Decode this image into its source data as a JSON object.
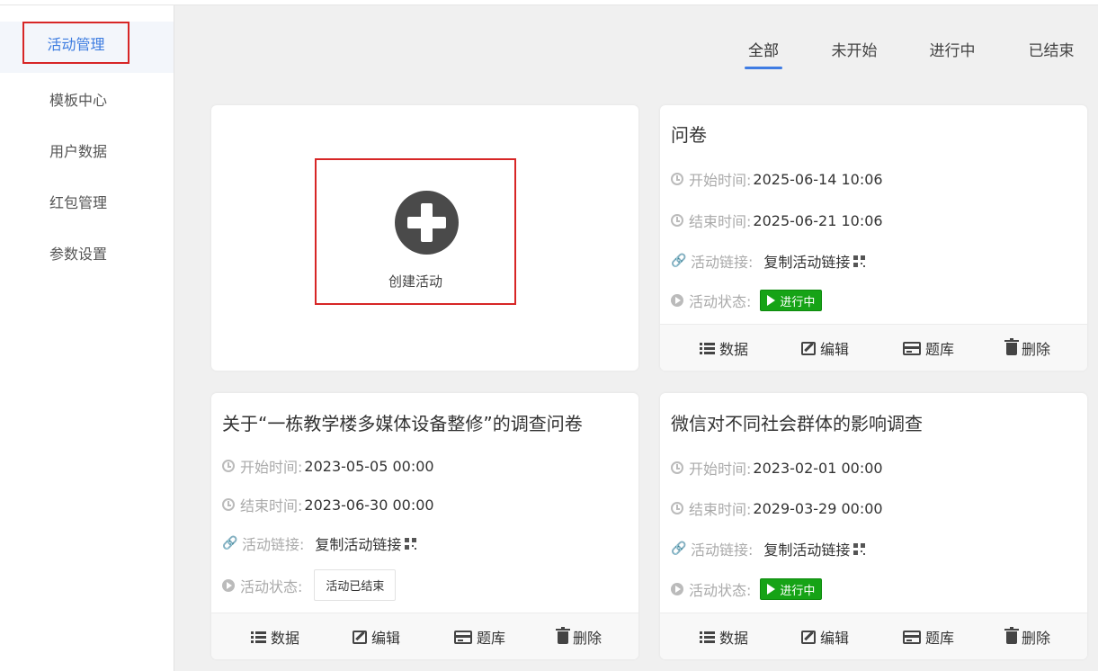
{
  "sidebar": {
    "items": [
      {
        "label": "活动管理"
      },
      {
        "label": "模板中心"
      },
      {
        "label": "用户数据"
      },
      {
        "label": "红包管理"
      },
      {
        "label": "参数设置"
      }
    ]
  },
  "tabs": [
    {
      "label": "全部"
    },
    {
      "label": "未开始"
    },
    {
      "label": "进行中"
    },
    {
      "label": "已结束"
    }
  ],
  "create": {
    "label": "创建活动"
  },
  "labels": {
    "start": "开始时间:",
    "end": "结束时间:",
    "link": "活动链接:",
    "status": "活动状态:",
    "copy_link": "复制活动链接"
  },
  "actions": {
    "data": "数据",
    "edit": "编辑",
    "bank": "题库",
    "delete": "删除"
  },
  "cards": [
    {
      "title": "问卷",
      "start": "2025-06-14 10:06",
      "end": "2025-06-21 10:06",
      "status": "进行中"
    },
    {
      "title": "关于“一栋教学楼多媒体设备整修”的调查问卷",
      "start": "2023-05-05 00:00",
      "end": "2023-06-30 00:00",
      "status": "活动已结束"
    },
    {
      "title": "微信对不同社会群体的影响调查",
      "start": "2023-02-01 00:00",
      "end": "2029-03-29 00:00",
      "status": "进行中"
    }
  ],
  "colors": {
    "accent": "#3f7ce3",
    "highlight_border": "#d72626",
    "running": "#16a316"
  }
}
